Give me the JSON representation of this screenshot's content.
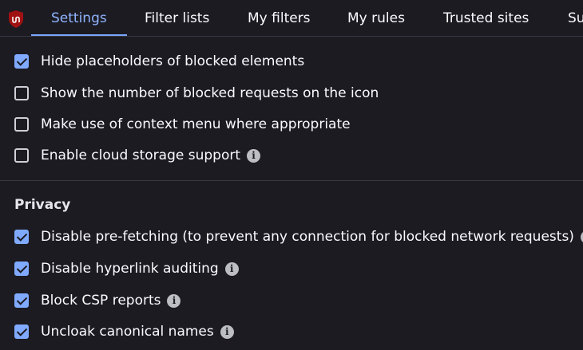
{
  "colors": {
    "background": "#1c1b22",
    "accent": "#80aaff",
    "active_tab_text": "#8fb4ff",
    "logo_red": "#a01212"
  },
  "header": {
    "logo_icon": "ublock-shield-logo",
    "tabs": [
      {
        "label": "Settings",
        "active": true
      },
      {
        "label": "Filter lists",
        "active": false
      },
      {
        "label": "My filters",
        "active": false
      },
      {
        "label": "My rules",
        "active": false
      },
      {
        "label": "Trusted sites",
        "active": false
      },
      {
        "label": "Su",
        "active": false
      }
    ]
  },
  "appearance": {
    "options": [
      {
        "label": "Hide placeholders of blocked elements",
        "checked": true,
        "info": false
      },
      {
        "label": "Show the number of blocked requests on the icon",
        "checked": false,
        "info": false
      },
      {
        "label": "Make use of context menu where appropriate",
        "checked": false,
        "info": false
      },
      {
        "label": "Enable cloud storage support",
        "checked": false,
        "info": true
      }
    ]
  },
  "privacy": {
    "heading": "Privacy",
    "options": [
      {
        "label": "Disable pre-fetching (to prevent any connection for blocked network requests)",
        "checked": true,
        "info": true
      },
      {
        "label": "Disable hyperlink auditing",
        "checked": true,
        "info": true
      },
      {
        "label": "Block CSP reports",
        "checked": true,
        "info": true
      },
      {
        "label": "Uncloak canonical names",
        "checked": true,
        "info": true
      }
    ]
  },
  "info_icon_glyph": "i"
}
